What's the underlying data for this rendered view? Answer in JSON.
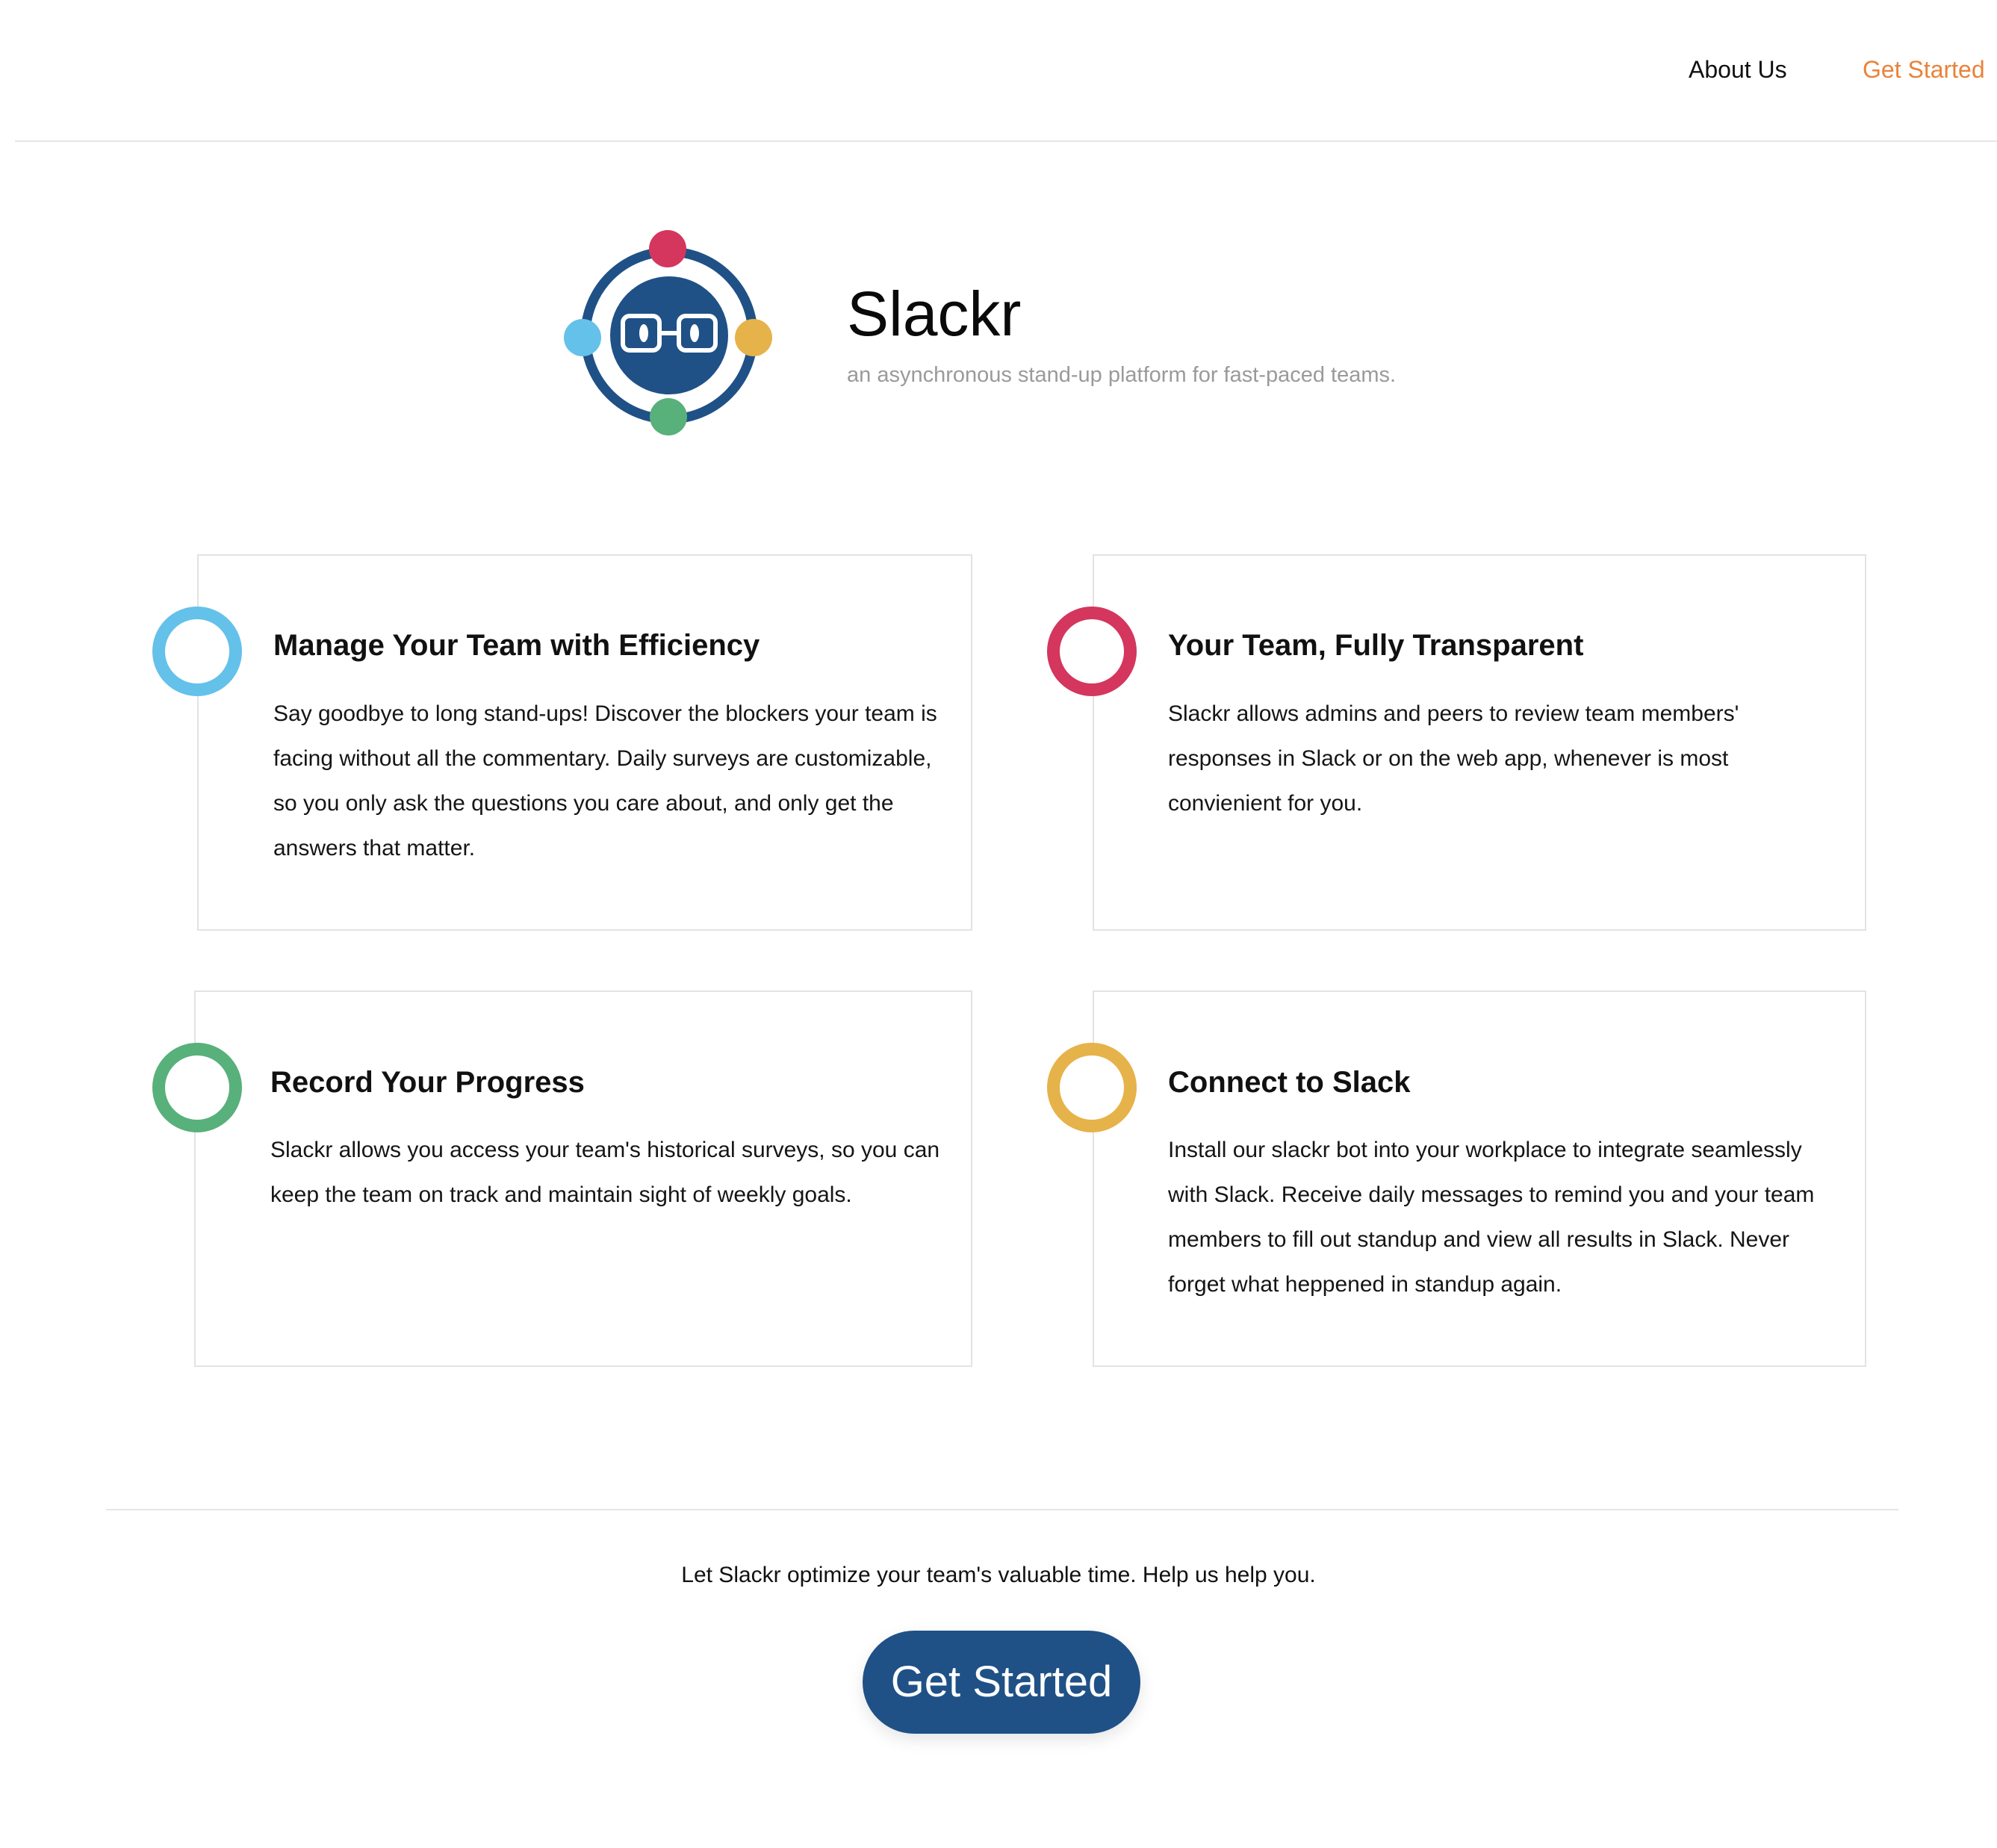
{
  "colors": {
    "brand_blue": "#1f5186",
    "accent_orange": "#e8833a",
    "blue": "#64c1ea",
    "red": "#d4365d",
    "green": "#58b07b",
    "yellow": "#e6b24a"
  },
  "nav": {
    "about_label": "About Us",
    "get_started_label": "Get Started"
  },
  "hero": {
    "logo_icon": "glasses-logo-icon",
    "title": "Slackr",
    "tagline": "an asynchronous stand-up platform for fast-paced teams."
  },
  "features": [
    {
      "ring_color": "#64c1ea",
      "title": "Manage Your Team with Efficiency",
      "text": "Say goodbye to long stand-ups! Discover the blockers your team is facing without all the commentary. Daily surveys are customizable, so you only ask the questions you care about, and only get the answers that matter."
    },
    {
      "ring_color": "#d4365d",
      "title": "Your Team, Fully Transparent",
      "text": "Slackr allows admins and peers to review team members' responses in Slack or on the web app, whenever is most convienient for you."
    },
    {
      "ring_color": "#58b07b",
      "title": "Record Your Progress",
      "text": "Slackr allows you access your team's historical surveys, so you can keep the team on track and maintain sight of weekly goals."
    },
    {
      "ring_color": "#e6b24a",
      "title": "Connect to Slack",
      "text": "Install our slackr bot into your workplace to integrate seamlessly with Slack. Receive daily messages to remind you and your team members to fill out standup and view all results in Slack. Never forget what heppened in standup again."
    }
  ],
  "footer": {
    "message": "Let Slackr optimize your team's valuable time. Help us help you.",
    "cta_label": "Get Started"
  }
}
